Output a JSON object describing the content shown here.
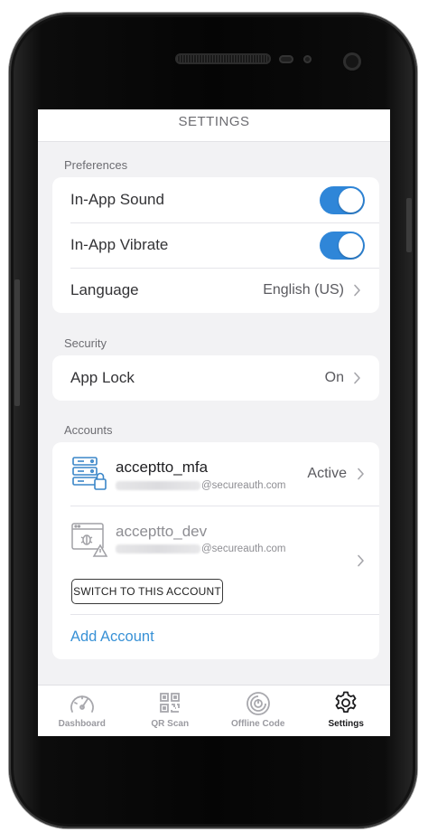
{
  "header": {
    "title": "SETTINGS"
  },
  "preferences": {
    "section_label": "Preferences",
    "in_app_sound": {
      "label": "In-App Sound",
      "enabled": true
    },
    "in_app_vibrate": {
      "label": "In-App Vibrate",
      "enabled": true
    },
    "language": {
      "label": "Language",
      "value": "English (US)"
    }
  },
  "security": {
    "section_label": "Security",
    "app_lock": {
      "label": "App Lock",
      "value": "On"
    }
  },
  "accounts": {
    "section_label": "Accounts",
    "items": [
      {
        "name": "acceptto_mfa",
        "email_domain": "@secureauth.com",
        "status": "Active"
      },
      {
        "name": "acceptto_dev",
        "email_domain": "@secureauth.com",
        "switch_label": "SWITCH TO THIS ACCOUNT"
      }
    ],
    "add_label": "Add Account"
  },
  "tabbar": {
    "tabs": [
      {
        "label": "Dashboard",
        "icon": "gauge-icon"
      },
      {
        "label": "QR Scan",
        "icon": "qr-code-icon"
      },
      {
        "label": "Offline Code",
        "icon": "offline-code-icon"
      },
      {
        "label": "Settings",
        "icon": "gear-icon",
        "active": true
      }
    ]
  },
  "colors": {
    "accent": "#2f86d8",
    "link": "#3891d6",
    "background": "#f2f2f4"
  }
}
